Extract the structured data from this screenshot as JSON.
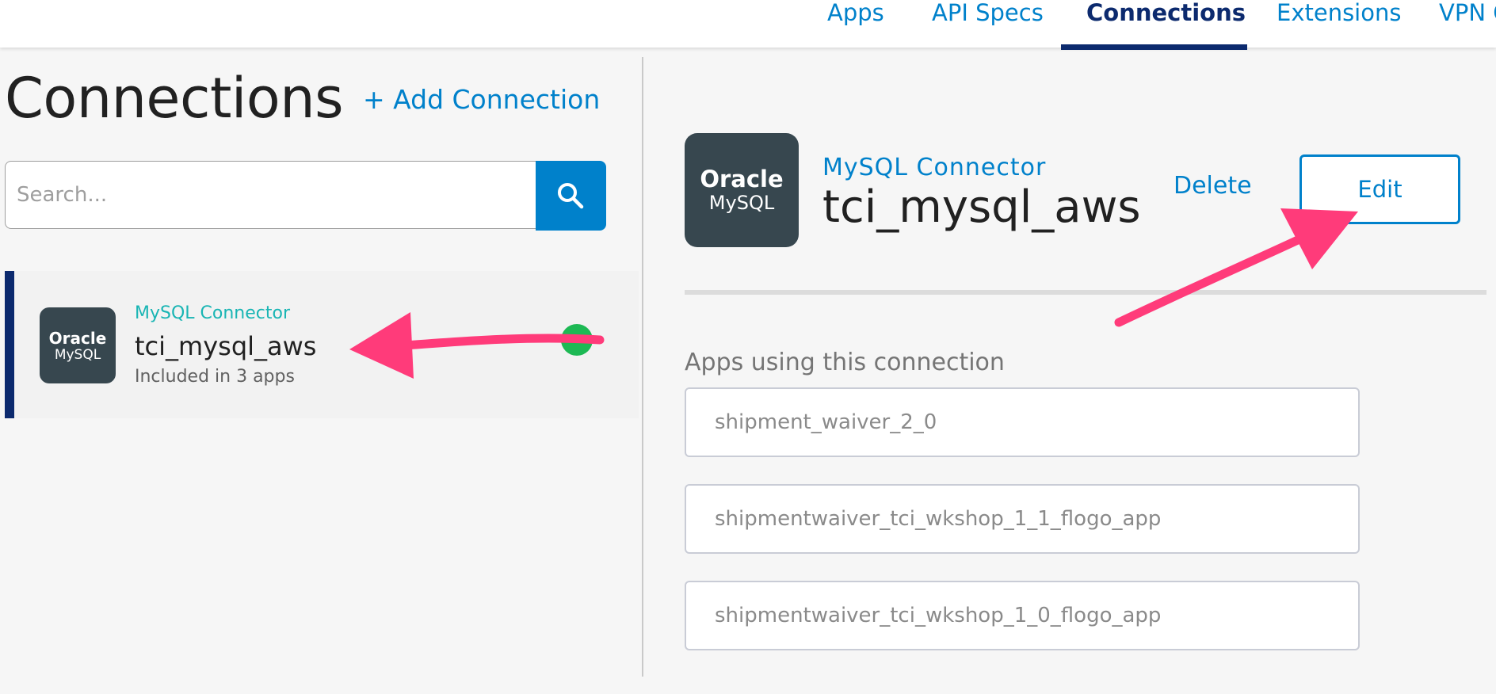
{
  "nav": {
    "tabs": [
      {
        "label": "Apps"
      },
      {
        "label": "API Specs"
      },
      {
        "label": "Connections"
      },
      {
        "label": "Extensions"
      },
      {
        "label": "VPN C"
      }
    ]
  },
  "left": {
    "title": "Connections",
    "add_label": "+ Add Connection",
    "search_placeholder": "Search...",
    "search_icon": "search-icon",
    "connections": [
      {
        "logo_brand": "Oracle",
        "logo_product": "MySQL",
        "type": "MySQL Connector",
        "name": "tci_mysql_aws",
        "meta": "Included in 3 apps",
        "status_color": "#1db954"
      }
    ]
  },
  "detail": {
    "logo_brand": "Oracle",
    "logo_product": "MySQL",
    "type": "MySQL Connector",
    "name": "tci_mysql_aws",
    "delete_label": "Delete",
    "edit_label": "Edit",
    "apps_heading": "Apps using this connection",
    "apps": [
      {
        "name": "shipment_waiver_2_0"
      },
      {
        "name": "shipmentwaiver_tci_wkshop_1_1_flogo_app"
      },
      {
        "name": "shipmentwaiver_tci_wkshop_1_0_flogo_app"
      }
    ]
  },
  "colors": {
    "accent": "#0081cb",
    "nav_active": "#0c2a6e",
    "teal": "#19b5b4",
    "status_ok": "#1db954",
    "logo_bg": "#37474f",
    "annotation_arrow": "#ff3b7a"
  }
}
